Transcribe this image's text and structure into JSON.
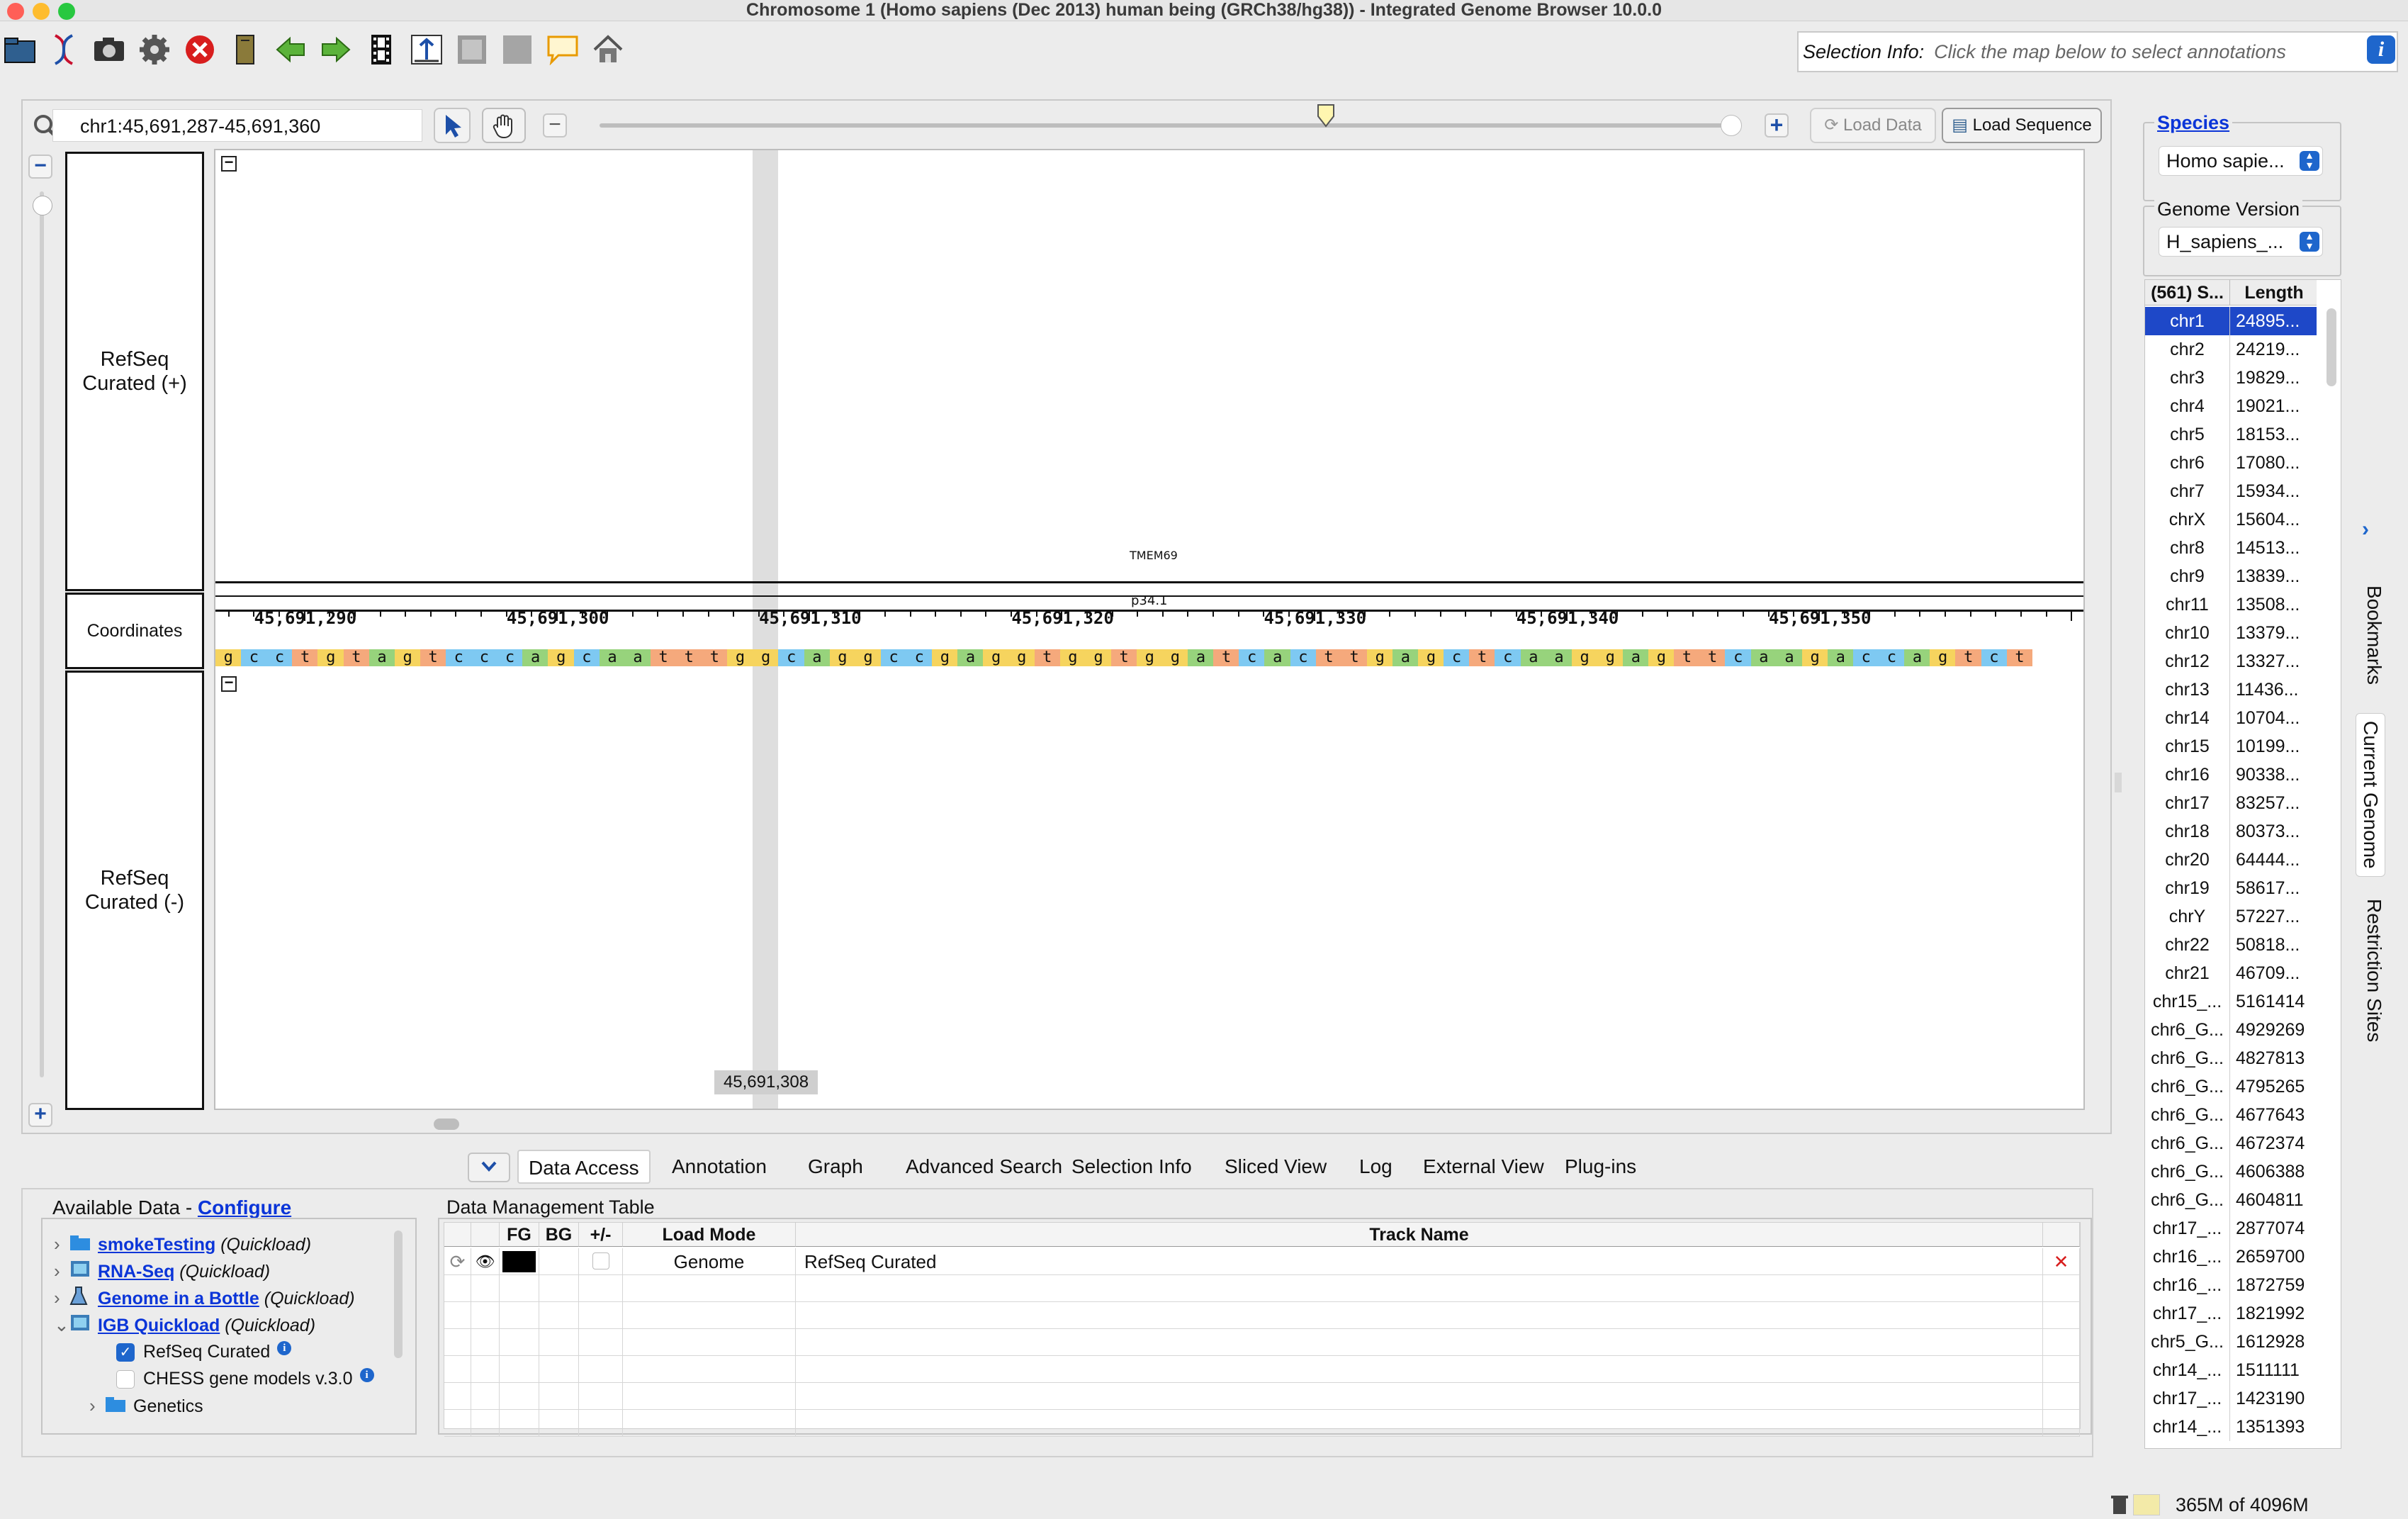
{
  "window": {
    "title": "Chromosome 1  (Homo sapiens (Dec 2013) human being (GRCh38/hg38)) - Integrated Genome Browser 10.0.0"
  },
  "toolbar": {
    "icons": [
      "open-folder-icon",
      "dna-icon",
      "camera-icon",
      "gear-icon",
      "stop-icon",
      "bookmark-icon",
      "back-arrow-icon",
      "forward-arrow-icon",
      "film-icon",
      "fit-icon",
      "gray-square-icon",
      "gray-square-icon",
      "comment-icon",
      "home-icon"
    ],
    "selection_label": "Selection Info:",
    "selection_placeholder": "Click the map below to select annotations"
  },
  "nav": {
    "location": "chr1:45,691,287-45,691,360",
    "load_data": "Load Data",
    "load_sequence": "Load Sequence",
    "zoom_level": 0.62
  },
  "tracks": {
    "plus_label": "RefSeq Curated (+)",
    "coord_label": "Coordinates",
    "minus_label": "RefSeq Curated (-)",
    "gene_label": "TMEM69",
    "band_label": "p34.1",
    "ruler_ticks": [
      "45,691,290",
      "45,691,300",
      "45,691,310",
      "45,691,320",
      "45,691,330",
      "45,691,340",
      "45,691,350"
    ],
    "sequence": "gcctgtagtcccagcaatttggcaggccgaggtggtggatcacttgagctcaaggagttcaagaccagtct",
    "cursor_position": "45,691,308",
    "base_colors": {
      "a": "#97d37c",
      "c": "#7ec9f2",
      "g": "#f6d45e",
      "t": "#f5a97c"
    }
  },
  "bottom_tabs": [
    "Data Access",
    "Annotation",
    "Graph",
    "Advanced Search",
    "Selection Info",
    "Sliced View",
    "Log",
    "External View",
    "Plug-ins"
  ],
  "available_data": {
    "header": "Available Data - ",
    "configure": "Configure",
    "items": [
      {
        "name": "smokeTesting",
        "note": "(Quickload)",
        "icon": "folder-icon"
      },
      {
        "name": "RNA-Seq",
        "note": "(Quickload)",
        "icon": "server-icon"
      },
      {
        "name": "Genome in a Bottle",
        "note": "(Quickload)",
        "icon": "flask-icon"
      },
      {
        "name": "IGB Quickload",
        "note": "(Quickload)",
        "icon": "server-icon"
      }
    ],
    "children": [
      {
        "name": "RefSeq Curated",
        "checked": true
      },
      {
        "name": "CHESS gene models v.3.0",
        "checked": false
      }
    ],
    "folder": "Genetics"
  },
  "data_table": {
    "header": "Data Management Table",
    "columns": [
      "FG",
      "BG",
      "+/-",
      "Load Mode",
      "Track Name"
    ],
    "rows": [
      {
        "load_mode": "Genome",
        "track_name": "RefSeq Curated"
      }
    ]
  },
  "side": {
    "species_label": "Species",
    "species_value": "Homo sapie...",
    "genome_label": "Genome Version",
    "genome_value": "H_sapiens_...",
    "col1": "(561) S...",
    "col2": "Length",
    "chromosomes": [
      [
        "chr1",
        "24895..."
      ],
      [
        "chr2",
        "24219..."
      ],
      [
        "chr3",
        "19829..."
      ],
      [
        "chr4",
        "19021..."
      ],
      [
        "chr5",
        "18153..."
      ],
      [
        "chr6",
        "17080..."
      ],
      [
        "chr7",
        "15934..."
      ],
      [
        "chrX",
        "15604..."
      ],
      [
        "chr8",
        "14513..."
      ],
      [
        "chr9",
        "13839..."
      ],
      [
        "chr11",
        "13508..."
      ],
      [
        "chr10",
        "13379..."
      ],
      [
        "chr12",
        "13327..."
      ],
      [
        "chr13",
        "11436..."
      ],
      [
        "chr14",
        "10704..."
      ],
      [
        "chr15",
        "10199..."
      ],
      [
        "chr16",
        "90338..."
      ],
      [
        "chr17",
        "83257..."
      ],
      [
        "chr18",
        "80373..."
      ],
      [
        "chr20",
        "64444..."
      ],
      [
        "chr19",
        "58617..."
      ],
      [
        "chrY",
        "57227..."
      ],
      [
        "chr22",
        "50818..."
      ],
      [
        "chr21",
        "46709..."
      ],
      [
        "chr15_...",
        "5161414"
      ],
      [
        "chr6_G...",
        "4929269"
      ],
      [
        "chr6_G...",
        "4827813"
      ],
      [
        "chr6_G...",
        "4795265"
      ],
      [
        "chr6_G...",
        "4677643"
      ],
      [
        "chr6_G...",
        "4672374"
      ],
      [
        "chr6_G...",
        "4606388"
      ],
      [
        "chr6_G...",
        "4604811"
      ],
      [
        "chr17_...",
        "2877074"
      ],
      [
        "chr16_...",
        "2659700"
      ],
      [
        "chr16_...",
        "1872759"
      ],
      [
        "chr17_...",
        "1821992"
      ],
      [
        "chr5_G...",
        "1612928"
      ],
      [
        "chr14_...",
        "1511111"
      ],
      [
        "chr17_...",
        "1423190"
      ],
      [
        "chr14_...",
        "1351393"
      ]
    ],
    "vertical_tabs": [
      "Bookmarks",
      "Current Genome",
      "Restriction Sites"
    ]
  },
  "status": {
    "memory": "365M of 4096M"
  }
}
